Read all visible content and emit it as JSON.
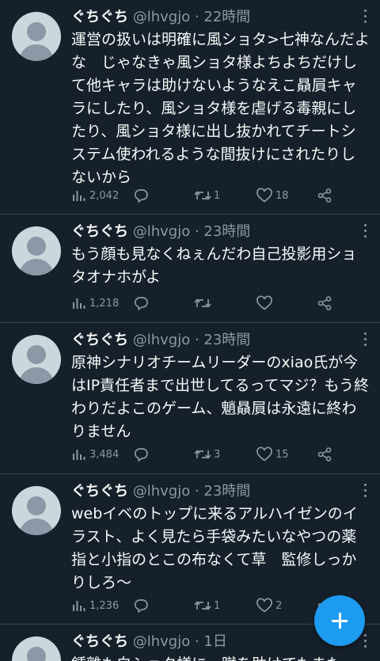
{
  "tweets": [
    {
      "name": "ぐちぐち",
      "handle": "@lhvgjo · 22時間",
      "text": "運営の扱いは明確に風ショタ>七神なんだよな　じゃなきゃ風ショタ様よちよちだけして他キャラは助けないようなえこ贔屓キャラにしたり、風ショタ様を虐げる毒親にしたり、風ショタ様に出し抜かれてチートシステム使われるような間抜けにされたりしないから",
      "views": "2,042",
      "replies": "",
      "retweets": "1",
      "likes": "18"
    },
    {
      "name": "ぐちぐち",
      "handle": "@lhvgjo · 23時間",
      "text": "もう顔も見なくねぇんだわ自己投影用ショタオナホがよ",
      "views": "1,218",
      "replies": "",
      "retweets": "",
      "likes": ""
    },
    {
      "name": "ぐちぐち",
      "handle": "@lhvgjo · 23時間",
      "text": "原神シナリオチームリーダーのxiao氏が今はIP責任者まで出世してるってマジ？もう終わりだよこのゲーム、魈贔屓は永遠に終わりません",
      "views": "3,484",
      "replies": "",
      "retweets": "3",
      "likes": "15"
    },
    {
      "name": "ぐちぐち",
      "handle": "@lhvgjo · 23時間",
      "text": "webイベのトップに来るアルハイゼンのイラスト、よく見たら手袋みたいなやつの薬指と小指のとこの布なくて草　監修しっかりしろ〜",
      "views": "1,236",
      "replies": "",
      "retweets": "1",
      "likes": "2"
    },
    {
      "name": "ぐちぐち",
      "handle": "@lhvgjo · 1日",
      "text": "鍾離も白ショタ様に一蹴を助けてもまた",
      "views": "",
      "replies": "",
      "retweets": "",
      "likes": ""
    }
  ],
  "icons": {
    "views": "views-icon",
    "reply": "reply-icon",
    "retweet": "retweet-icon",
    "like": "like-icon",
    "share": "share-icon",
    "compose": "plus-icon"
  },
  "colors": {
    "background": "#15202b",
    "text": "#f7f9f9",
    "secondary": "#8b98a5",
    "accent": "#1d9bf0",
    "divider": "#38444d"
  }
}
